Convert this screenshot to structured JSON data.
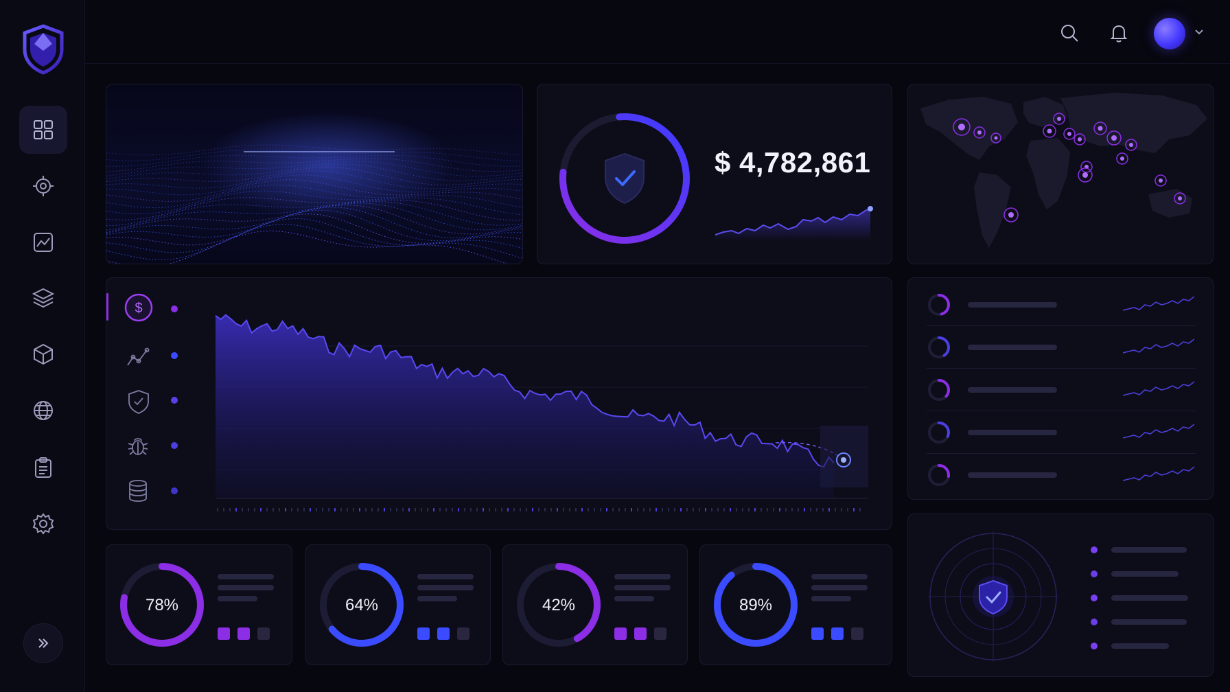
{
  "app": {
    "brand_color": "#4a2bd8",
    "accent_purple": "#8b2ee6",
    "accent_blue": "#3b4bff"
  },
  "sidebar": {
    "items": [
      {
        "icon": "grid-icon",
        "active": true
      },
      {
        "icon": "target-icon"
      },
      {
        "icon": "chart-icon"
      },
      {
        "icon": "layers-icon"
      },
      {
        "icon": "cube-icon"
      },
      {
        "icon": "globe-icon"
      },
      {
        "icon": "clipboard-icon"
      },
      {
        "icon": "gear-icon"
      }
    ],
    "expand_icon": "double-chevron-right-icon"
  },
  "header": {
    "search_icon": "search-icon",
    "bell_icon": "bell-icon",
    "avatar_icon": "avatar",
    "menu_icon": "chevron-down-icon"
  },
  "balance": {
    "amount": "$ 4,782,861",
    "ring_progress": 0.78
  },
  "main_chart": {
    "categories": [
      {
        "icon": "dollar-icon",
        "active": true
      },
      {
        "icon": "trend-icon"
      },
      {
        "icon": "shield-check-icon"
      },
      {
        "icon": "bug-icon"
      },
      {
        "icon": "database-icon"
      }
    ]
  },
  "gauges": [
    {
      "label": "78%",
      "value": 78,
      "color": "#8b2ee6"
    },
    {
      "label": "64%",
      "value": 64,
      "color": "#3b4bff"
    },
    {
      "label": "42%",
      "value": 42,
      "color": "#8b2ee6"
    },
    {
      "label": "89%",
      "value": 89,
      "color": "#3b4bff"
    }
  ],
  "side_list": {
    "rows": 5
  },
  "radar": {
    "legend_items": 5
  }
}
